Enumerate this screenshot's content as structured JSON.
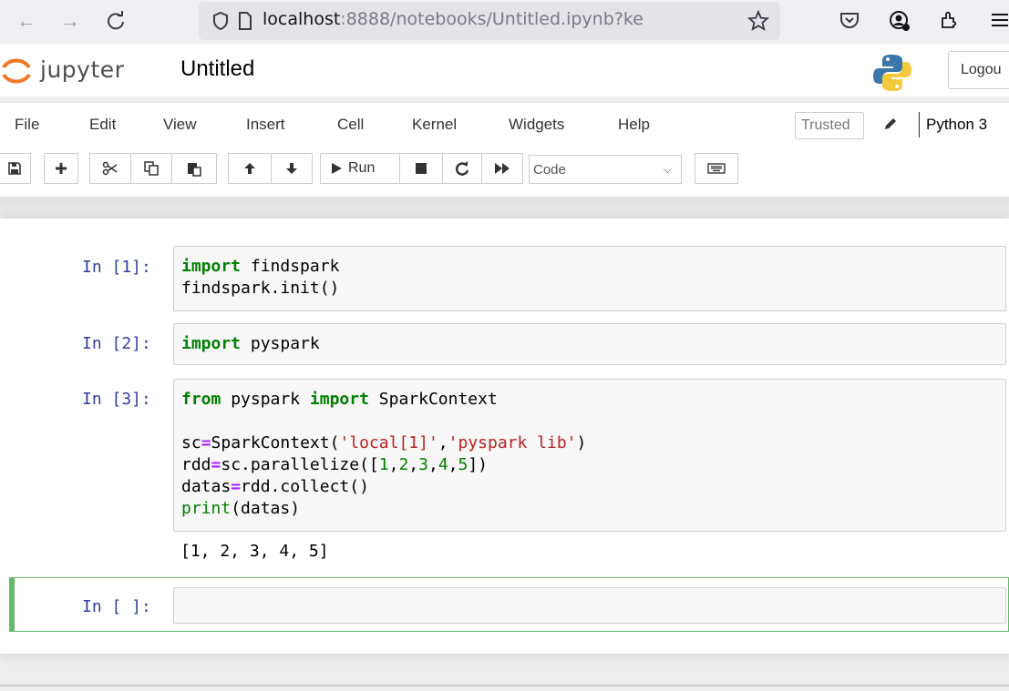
{
  "browser": {
    "url_host": "localhost",
    "url_rest": ":8888/notebooks/Untitled.ipynb?ke"
  },
  "header": {
    "brand": "jupyter",
    "notebook_title": "Untitled",
    "logout_label": "Logou"
  },
  "menu": {
    "items": [
      "File",
      "Edit",
      "View",
      "Insert",
      "Cell",
      "Kernel",
      "Widgets",
      "Help"
    ],
    "trusted_label": "Trusted",
    "kernel_name": "Python 3"
  },
  "toolbar": {
    "run_label": "Run",
    "cell_type": "Code"
  },
  "cells": [
    {
      "prompt": "In [1]:",
      "lines": [
        "import findspark",
        "findspark.init()"
      ],
      "output": ""
    },
    {
      "prompt": "In [2]:",
      "lines": [
        "import pyspark"
      ],
      "output": ""
    },
    {
      "prompt": "In [3]:",
      "lines": [
        "from pyspark import SparkContext",
        "",
        "sc=SparkContext('local[1]','pyspark lib')",
        "rdd=sc.parallelize([1,2,3,4,5])",
        "datas=rdd.collect()",
        "print(datas)"
      ],
      "output": "[1, 2, 3, 4, 5]"
    },
    {
      "prompt": "In [ ]:",
      "lines": [
        ""
      ],
      "output": ""
    }
  ]
}
